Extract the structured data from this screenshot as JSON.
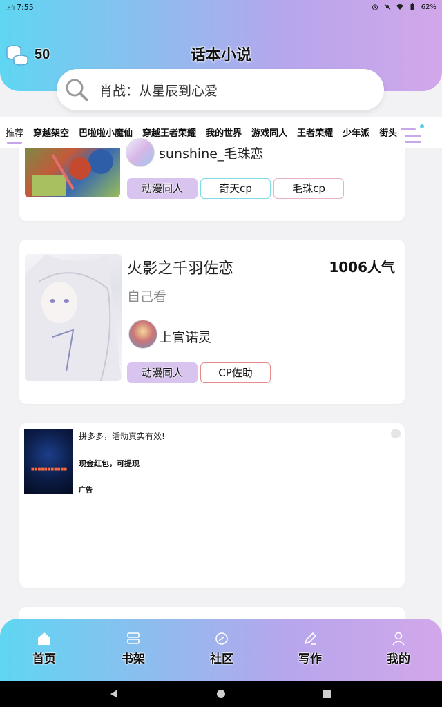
{
  "status_bar": {
    "am_pm": "上午",
    "time": "7:55",
    "battery": "62%"
  },
  "header": {
    "coins": "50",
    "title": "话本小说"
  },
  "search": {
    "placeholder": "肖战：从星辰到心爱"
  },
  "categories": [
    "推荐",
    "穿越架空",
    "巴啦啦小魔仙",
    "穿越王者荣耀",
    "我的世界",
    "游戏同人",
    "王者荣耀",
    "少年派",
    "街头"
  ],
  "cards": [
    {
      "author": "sunshine_毛珠恋",
      "tags": [
        "动漫同人",
        "奇天cp",
        "毛珠cp"
      ]
    },
    {
      "title": "火影之千羽佐恋",
      "subtitle": "自己看",
      "popularity": "1006人气",
      "author": "上官诺灵",
      "tags": [
        "动漫同人",
        "CP佐助"
      ]
    }
  ],
  "ad": {
    "line1": "拼多多，活动真实有效!",
    "line2": "现金红包，可提现",
    "badge": "广告",
    "image_text": "■■■■■■■■■■■"
  },
  "bottom_nav": [
    "首页",
    "书架",
    "社区",
    "写作",
    "我的"
  ],
  "colors": {
    "accent_start": "#5fd6f2",
    "accent_end": "#d2a7ea",
    "tag_purple": "#d8c4ee"
  }
}
